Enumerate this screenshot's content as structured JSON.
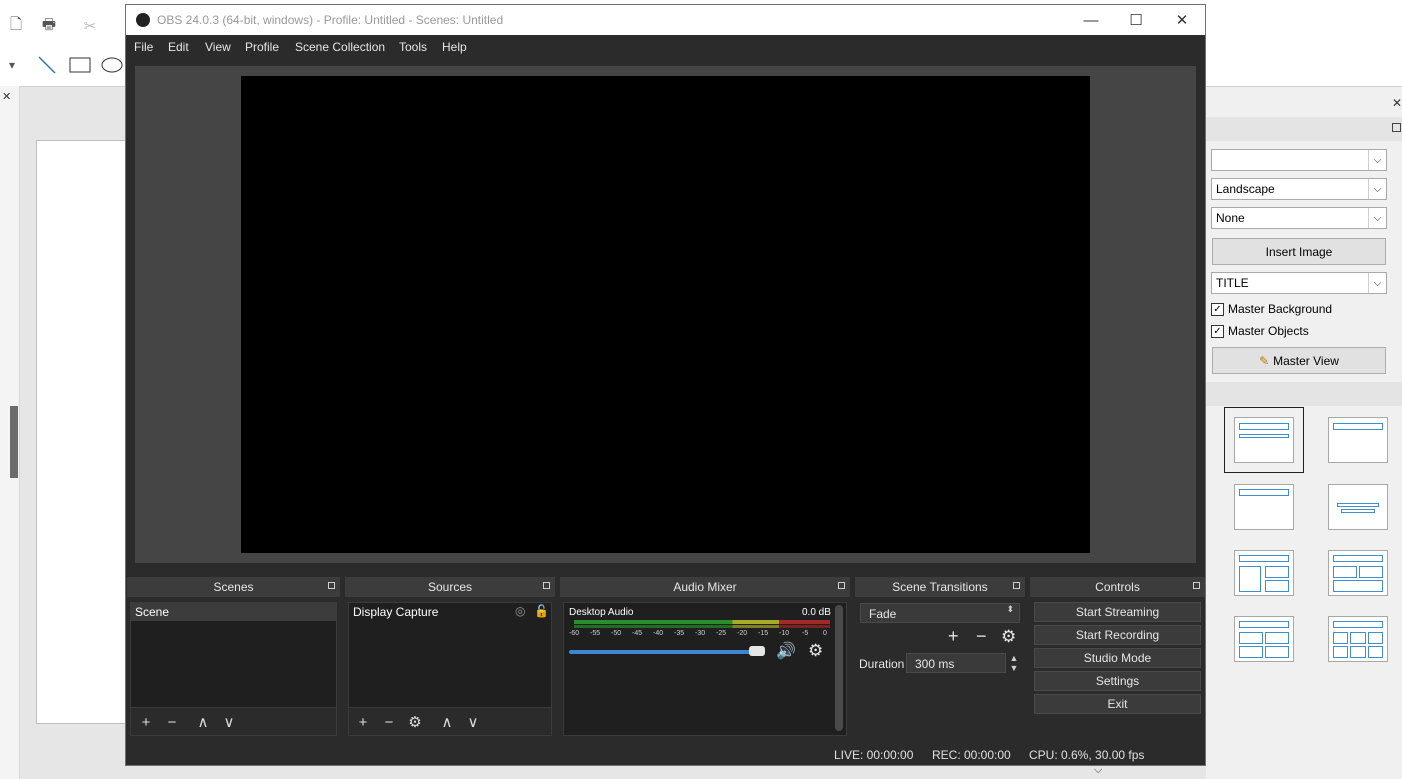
{
  "obs": {
    "title": "OBS 24.0.3 (64-bit, windows) - Profile: Untitled - Scenes: Untitled",
    "window_controls": {
      "minimize": "—",
      "maximize": "☐",
      "close": "✕"
    },
    "menu": [
      "File",
      "Edit",
      "View",
      "Profile",
      "Scene Collection",
      "Tools",
      "Help"
    ],
    "docks": {
      "scenes": {
        "title": "Scenes",
        "items": [
          "Scene"
        ],
        "toolbar": [
          "+",
          "−",
          "∧",
          "∨"
        ]
      },
      "sources": {
        "title": "Sources",
        "items": [
          "Display Capture"
        ],
        "toolbar": [
          "+",
          "−",
          "⚙",
          "∧",
          "∨"
        ]
      },
      "audio_mixer": {
        "title": "Audio Mixer",
        "channel": "Desktop Audio",
        "level": "0.0 dB",
        "volume_fraction": 0.97,
        "scale": [
          "-60",
          "-55",
          "-50",
          "-45",
          "-40",
          "-35",
          "-30",
          "-25",
          "-20",
          "-15",
          "-10",
          "-5",
          "0"
        ]
      },
      "scene_transitions": {
        "title": "Scene Transitions",
        "transition": "Fade",
        "duration_label": "Duration",
        "duration_value": "300 ms"
      },
      "controls": {
        "title": "Controls",
        "buttons": [
          "Start Streaming",
          "Start Recording",
          "Studio Mode",
          "Settings",
          "Exit"
        ]
      }
    },
    "status": {
      "live": "LIVE: 00:00:00",
      "rec": "REC: 00:00:00",
      "cpu": "CPU: 0.6%, 30.00 fps"
    }
  },
  "sidebar": {
    "selects": [
      "",
      "Landscape",
      "None"
    ],
    "insert_image": "Insert Image",
    "layout_select": "TITLE",
    "master_background": "Master Background",
    "master_objects": "Master Objects",
    "master_view": "Master View"
  },
  "colors": {
    "obs_bg": "#2b2b2b",
    "obs_dock_title": "#3c3c3c",
    "volume_slider": "#3d86d2",
    "meter_green": "#2a8f2a",
    "meter_yellow": "#a8a82a",
    "meter_red": "#a02a2a"
  }
}
